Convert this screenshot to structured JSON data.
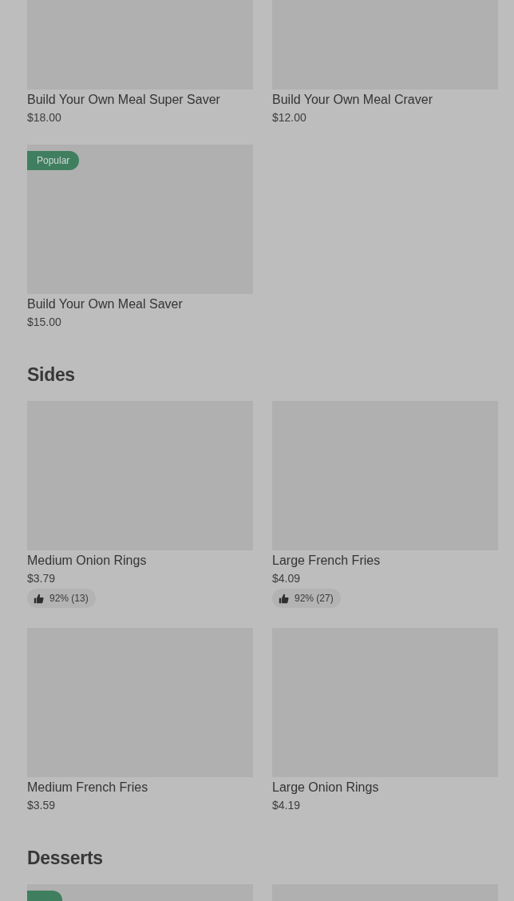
{
  "sections": [
    {
      "items": [
        {
          "name": "Build Your Own Meal Super Saver",
          "price": "$18.00"
        },
        {
          "name": "Build Your Own Meal Craver",
          "price": "$12.00"
        },
        {
          "name": "Build Your Own Meal Saver",
          "price": "$15.00",
          "badge": "Popular"
        }
      ]
    },
    {
      "title": "Sides",
      "items": [
        {
          "name": "Medium Onion Rings",
          "price": "$3.79",
          "rating": "92% (13)"
        },
        {
          "name": "Large French Fries",
          "price": "$4.09",
          "rating": "92% (27)"
        },
        {
          "name": "Medium French Fries",
          "price": "$3.59"
        },
        {
          "name": "Large Onion Rings",
          "price": "$4.19"
        }
      ]
    },
    {
      "title": "Desserts",
      "items": [
        {
          "kind": "picture",
          "badge_cut": true
        },
        {
          "kind": "picture"
        }
      ]
    }
  ]
}
